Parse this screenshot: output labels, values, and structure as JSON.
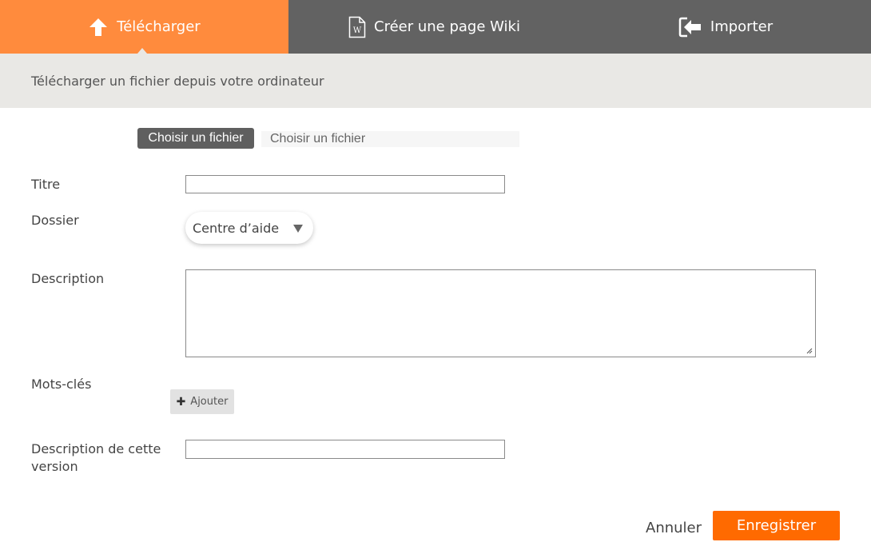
{
  "tabs": {
    "upload": {
      "label": "Télécharger",
      "icon": "arrow-up-icon",
      "active": true
    },
    "wiki": {
      "label": "Créer une page Wiki",
      "icon": "wiki-page-icon"
    },
    "import": {
      "label": "Importer",
      "icon": "import-icon"
    }
  },
  "subheader": {
    "text": "Télécharger un fichier depuis votre ordinateur"
  },
  "file": {
    "button_label": "Choisir un fichier",
    "selected_text": "Choisir un fichier"
  },
  "form": {
    "titre": {
      "label": "Titre",
      "value": ""
    },
    "dossier": {
      "label": "Dossier",
      "selected": "Centre d’aide"
    },
    "description": {
      "label": "Description",
      "value": ""
    },
    "mots_cles": {
      "label": "Mots-clés",
      "add_label": "Ajouter"
    },
    "version": {
      "label": "Description de cette version",
      "value": ""
    }
  },
  "actions": {
    "cancel_label": "Annuler",
    "save_label": "Enregistrer"
  },
  "colors": {
    "accent": "#ff8b3d",
    "save": "#ff6a00",
    "tabbar": "#626262",
    "subheader_bg": "#e9e8e5"
  }
}
